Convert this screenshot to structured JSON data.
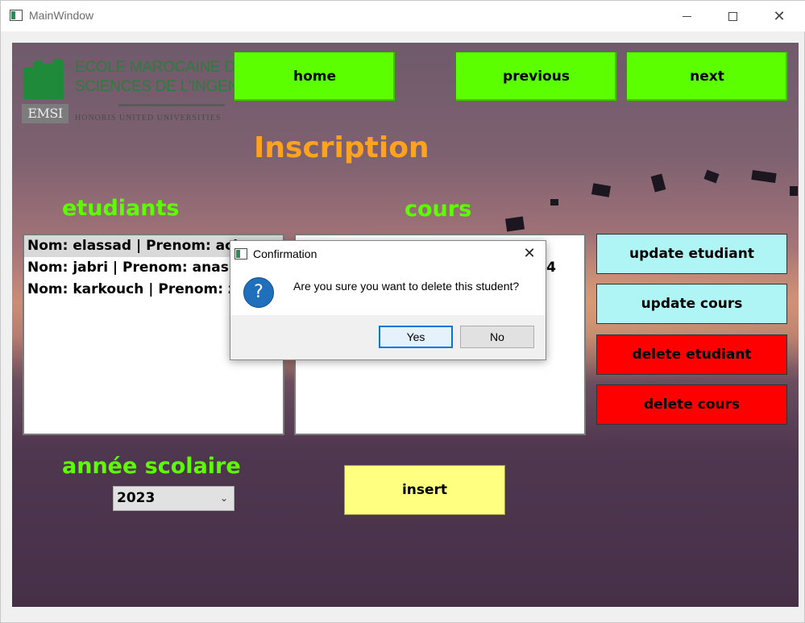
{
  "window": {
    "title": "MainWindow"
  },
  "logo": {
    "line1": "ECOLE MAROCAINE DES",
    "line2": "SCIENCES DE L'INGENIEUR",
    "tagline": "HONORIS UNITED UNIVERSITIES",
    "badge": "EMSI"
  },
  "nav": {
    "home": "home",
    "previous": "previous",
    "next": "next"
  },
  "page_title": "Inscription",
  "etudiants": {
    "heading": "etudiants",
    "items": [
      "Nom: elassad | Prenom: ach",
      "Nom: jabri | Prenom: anas",
      "Nom: karkouch | Prenom: z"
    ],
    "selected_index": 0
  },
  "cours": {
    "heading": "cours",
    "items": [
      "",
      "4"
    ]
  },
  "actions": {
    "update_etudiant": "update etudiant",
    "update_cours": "update cours",
    "delete_etudiant": "delete etudiant",
    "delete_cours": "delete cours",
    "insert": "insert"
  },
  "annee": {
    "heading": "année scolaire",
    "selected": "2023"
  },
  "dialog": {
    "title": "Confirmation",
    "message": "Are you sure you want to delete this student?",
    "yes": "Yes",
    "no": "No"
  },
  "colors": {
    "nav_button": "#5cff00",
    "update_button": "#aff5f5",
    "delete_button": "#ff0000",
    "insert_button": "#ffff80",
    "title": "#ffa21f",
    "heading": "#5cff00"
  }
}
